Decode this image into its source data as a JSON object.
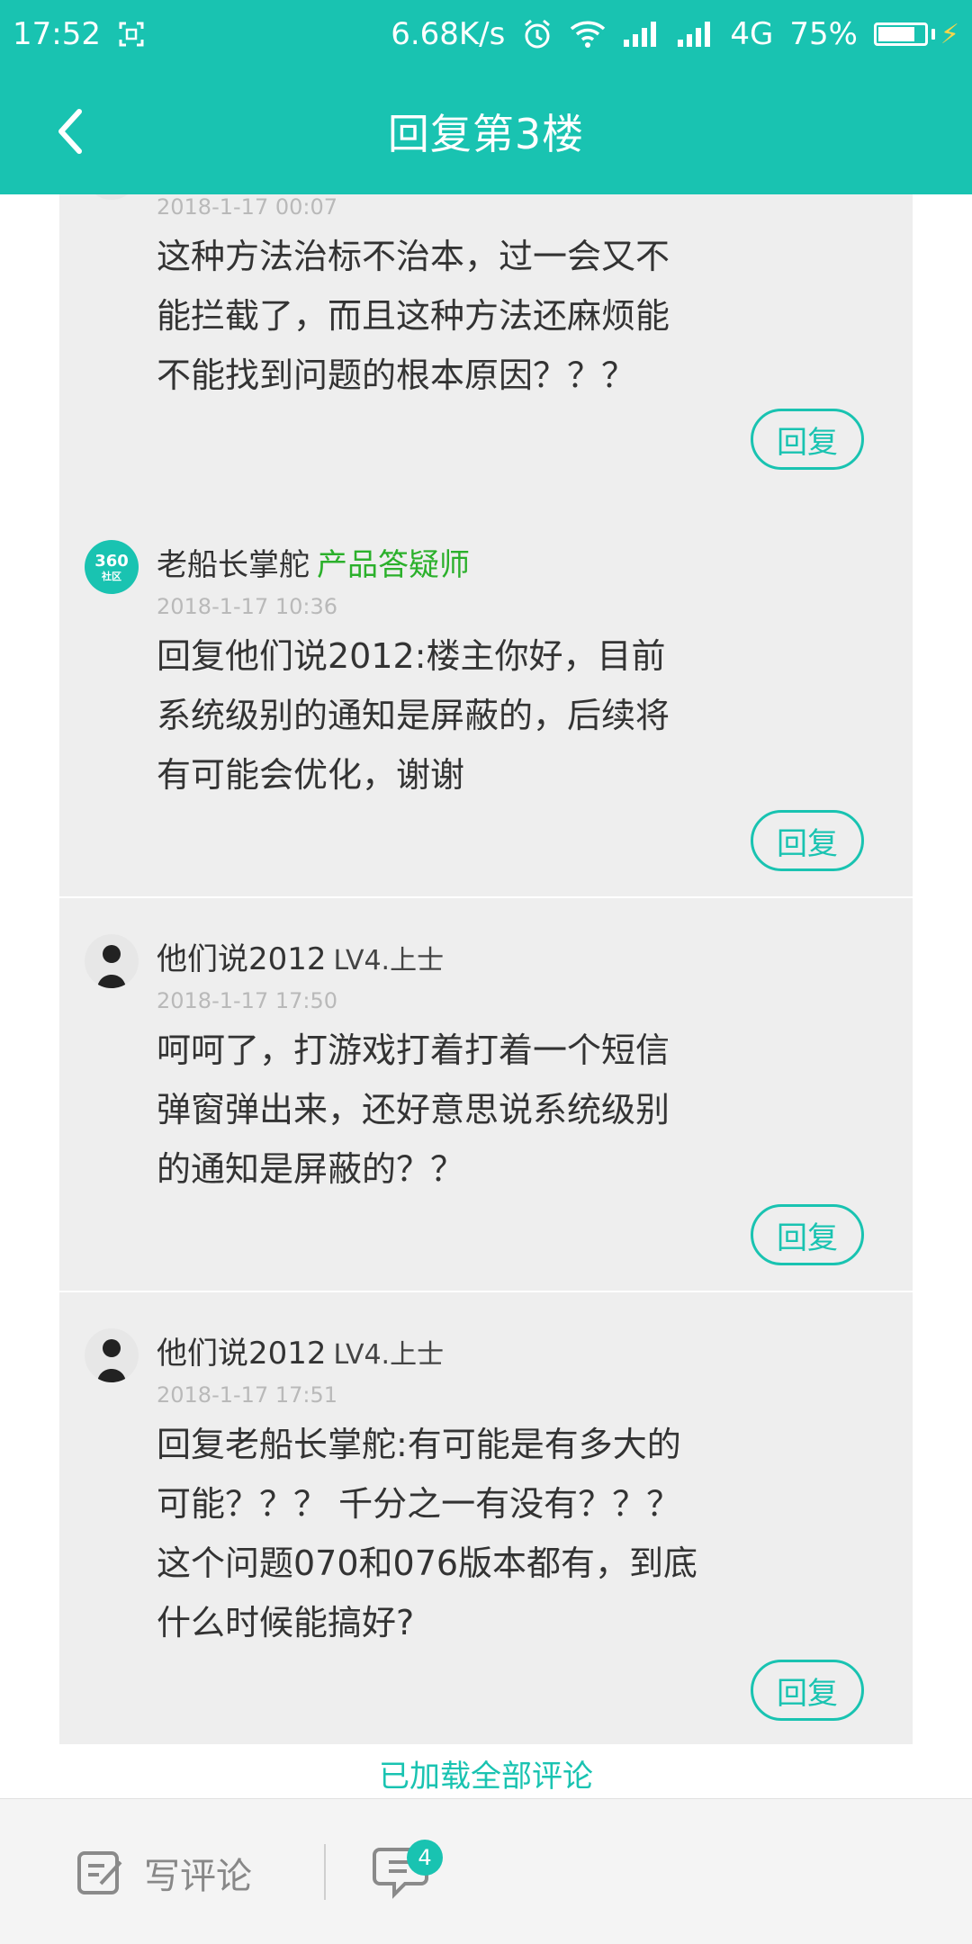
{
  "status": {
    "time": "17:52",
    "speed": "6.68K/s",
    "network": "4G",
    "battery": "75%"
  },
  "header": {
    "title": "回复第3楼"
  },
  "comments": [
    {
      "name": "",
      "time": "2018-1-17 00:07",
      "text": "这种方法治标不治本，过一会又不\n能拦截了，而且这种方法还麻烦能\n不能找到问题的根本原因？？？",
      "reply_label": "回复"
    },
    {
      "avatar_text_top": "360",
      "avatar_text_bottom": "社区",
      "name": "老船长掌舵",
      "badge": "产品答疑师",
      "time": "2018-1-17 10:36",
      "text": "回复他们说2012:楼主你好，目前\n系统级别的通知是屏蔽的，后续将\n有可能会优化，谢谢",
      "reply_label": "回复"
    },
    {
      "name": "他们说2012",
      "level": "LV4.上士",
      "time": "2018-1-17 17:50",
      "text": "呵呵了，打游戏打着打着一个短信\n弹窗弹出来，还好意思说系统级别\n的通知是屏蔽的？？",
      "reply_label": "回复"
    },
    {
      "name": "他们说2012",
      "level": "LV4.上士",
      "time": "2018-1-17 17:51",
      "text": "回复老船长掌舵:有可能是有多大的\n可能？？？ 千分之一有没有？？？\n这个问题070和076版本都有，到底\n什么时候能搞好?",
      "reply_label": "回复"
    }
  ],
  "footer": {
    "loaded_all": "已加载全部评论",
    "write_label": "写评论",
    "comment_count": "4"
  },
  "colors": {
    "accent": "#19c3b1",
    "badge_green": "#2bb02b"
  }
}
